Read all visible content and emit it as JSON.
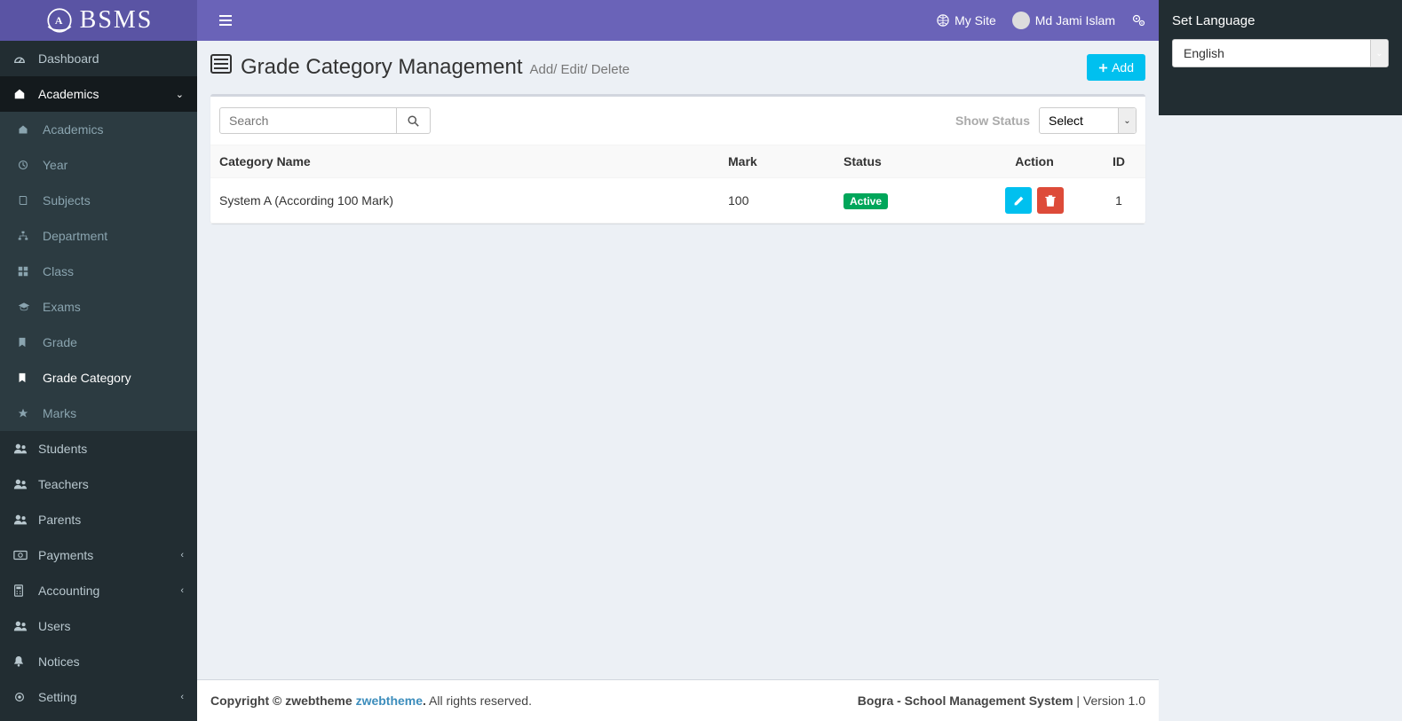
{
  "brand": "BSMS",
  "header": {
    "my_site": "My Site",
    "user_name": "Md Jami Islam"
  },
  "sidebar": {
    "items": [
      {
        "label": "Dashboard"
      },
      {
        "label": "Academics"
      },
      {
        "label": "Students"
      },
      {
        "label": "Teachers"
      },
      {
        "label": "Parents"
      },
      {
        "label": "Payments"
      },
      {
        "label": "Accounting"
      },
      {
        "label": "Users"
      },
      {
        "label": "Notices"
      },
      {
        "label": "Setting"
      }
    ],
    "academics_sub": [
      {
        "label": "Academics"
      },
      {
        "label": "Year"
      },
      {
        "label": "Subjects"
      },
      {
        "label": "Department"
      },
      {
        "label": "Class"
      },
      {
        "label": "Exams"
      },
      {
        "label": "Grade"
      },
      {
        "label": "Grade Category"
      },
      {
        "label": "Marks"
      }
    ]
  },
  "page": {
    "title": "Grade Category Management",
    "subtitle": "Add/ Edit/ Delete",
    "add_button": "Add",
    "search_placeholder": "Search",
    "show_status_label": "Show Status",
    "status_select_value": "Select"
  },
  "table": {
    "columns": [
      "Category Name",
      "Mark",
      "Status",
      "Action",
      "ID"
    ],
    "rows": [
      {
        "category_name": "System A (According 100 Mark)",
        "mark": "100",
        "status": "Active",
        "id": "1"
      }
    ]
  },
  "footer": {
    "copyright_prefix": "Copyright © zwebtheme ",
    "link_text": "zwebtheme",
    "copyright_suffix": " All rights reserved.",
    "app_name": "Bogra - School Management System",
    "version_prefix": " | Version ",
    "version": "1.0"
  },
  "right_panel": {
    "title": "Set Language",
    "language": "English"
  },
  "icons": {
    "dashboard": "dashboard",
    "home": "home",
    "globe": "globe",
    "gears": "gears"
  }
}
